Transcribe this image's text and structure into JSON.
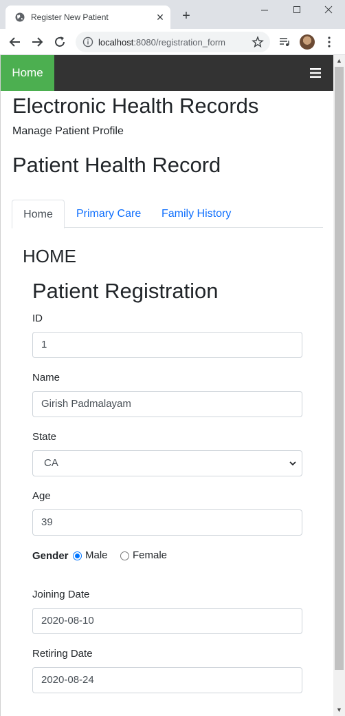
{
  "browser": {
    "tab_title": "Register New Patient",
    "url_host": "localhost",
    "url_path": ":8080/registration_form"
  },
  "navbar": {
    "home_label": "Home",
    "menu_icon": "hamburger-icon",
    "home_bg": "#4caf50",
    "bar_bg": "#333333"
  },
  "header": {
    "app_title": "Electronic Health Records",
    "subtitle": "Manage Patient Profile",
    "record_title": "Patient Health Record"
  },
  "tabs": [
    {
      "label": "Home",
      "active": true
    },
    {
      "label": "Primary Care",
      "active": false
    },
    {
      "label": "Family History",
      "active": false
    }
  ],
  "section_title": "HOME",
  "form": {
    "title": "Patient Registration",
    "id": {
      "label": "ID",
      "value": "1"
    },
    "name": {
      "label": "Name",
      "value": "Girish Padmalayam"
    },
    "state": {
      "label": "State",
      "value": "CA"
    },
    "age": {
      "label": "Age",
      "value": "39"
    },
    "gender": {
      "label": "Gender",
      "options": [
        "Male",
        "Female"
      ],
      "selected": "Male"
    },
    "joining_date": {
      "label": "Joining Date",
      "value": "2020-08-10"
    },
    "retiring_date": {
      "label": "Retiring Date",
      "value": "2020-08-24"
    }
  }
}
